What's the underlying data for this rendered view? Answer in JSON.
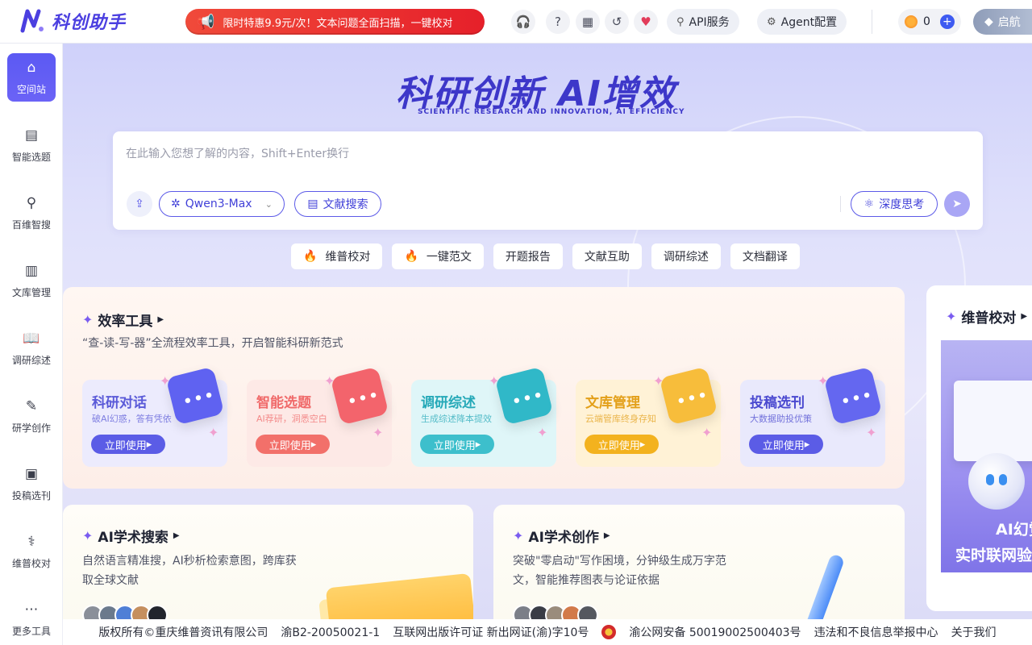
{
  "header": {
    "brand": "科创助手",
    "promo": "限时特惠9.9元/次！文本问题全面扫描，一键校对",
    "icons": [
      "headset-icon",
      "help-icon",
      "calendar-icon",
      "history-icon",
      "heart-pulse-icon"
    ],
    "api_label": "API服务",
    "agent_label": "Agent配置",
    "coins": "0",
    "vip_label": "启航"
  },
  "sidebar": {
    "items": [
      {
        "label": "空间站",
        "icon": "home-icon",
        "active": true
      },
      {
        "label": "智能选题",
        "icon": "clipboard-icon"
      },
      {
        "label": "百维智搜",
        "icon": "search-people-icon"
      },
      {
        "label": "文库管理",
        "icon": "library-icon"
      },
      {
        "label": "调研综述",
        "icon": "book-open-icon"
      },
      {
        "label": "研学创作",
        "icon": "edit-icon"
      },
      {
        "label": "投稿选刊",
        "icon": "journal-icon"
      },
      {
        "label": "维普校对",
        "icon": "stethoscope-icon"
      },
      {
        "label": "更多工具",
        "icon": "more-icon"
      }
    ]
  },
  "hero": {
    "title": "科研创新 AI增效",
    "subtitle": "SCIENTIFIC RESEARCH AND INNOVATION, AI EFFICIENCY"
  },
  "search": {
    "placeholder": "在此输入您想了解的内容，Shift+Enter换行",
    "model": "Qwen3-Max",
    "lit_search_label": "文献搜索",
    "deep_think_label": "深度思考"
  },
  "quick_chips": [
    {
      "label": "维普校对",
      "hot": true
    },
    {
      "label": "一键范文",
      "hot": true
    },
    {
      "label": "开题报告",
      "hot": false
    },
    {
      "label": "文献互助",
      "hot": false
    },
    {
      "label": "调研综述",
      "hot": false
    },
    {
      "label": "文档翻译",
      "hot": false
    }
  ],
  "efficiency": {
    "title": "效率工具",
    "desc": "“查-读-写-器”全流程效率工具，开启智能科研新范式",
    "use_label": "立即使用",
    "tools": [
      {
        "name": "科研对话",
        "sub": "破AI幻惑，答有凭依",
        "color": "#5a5ad8",
        "btn": "#5b5ce6",
        "bg": "#ecebfd",
        "art": "#5f62f1"
      },
      {
        "name": "智能选题",
        "sub": "AI荐研，洞悉空白",
        "color": "#f06a6a",
        "btn": "#f2706a",
        "bg": "#fde9e6",
        "art": "#f3646c"
      },
      {
        "name": "调研综述",
        "sub": "生成综述降本提效",
        "color": "#26a9b8",
        "btn": "#3dbfcc",
        "bg": "#dff6f8",
        "art": "#30b8c8"
      },
      {
        "name": "文库管理",
        "sub": "云端管库终身存知",
        "color": "#e3a01a",
        "btn": "#f3b21e",
        "bg": "#fff2d6",
        "art": "#f7bd3b"
      },
      {
        "name": "投稿选刊",
        "sub": "大数据助投优策",
        "color": "#4b4ad0",
        "btn": "#5b5ce6",
        "bg": "#e9e9fc",
        "art": "#6467f0"
      }
    ]
  },
  "side_panel": {
    "title": "维普校对",
    "line1": "AI幻觉",
    "line2": "实时联网验"
  },
  "ai_search": {
    "title": "AI学术搜索",
    "desc": "自然语言精准搜，AI秒析检索意图，跨库获取全球文献"
  },
  "ai_write": {
    "title": "AI学术创作",
    "desc": "突破\"零启动\"写作困境，分钟级生成万字范文，智能推荐图表与论证依据"
  },
  "footer": {
    "copyright": "版权所有©重庆维普资讯有限公司",
    "icp": "渝B2-20050021-1",
    "publish": "互联网出版许可证 新出网证(渝)字10号",
    "police": "渝公网安备 50019002500403号",
    "report": "违法和不良信息举报中心",
    "about": "关于我们"
  }
}
